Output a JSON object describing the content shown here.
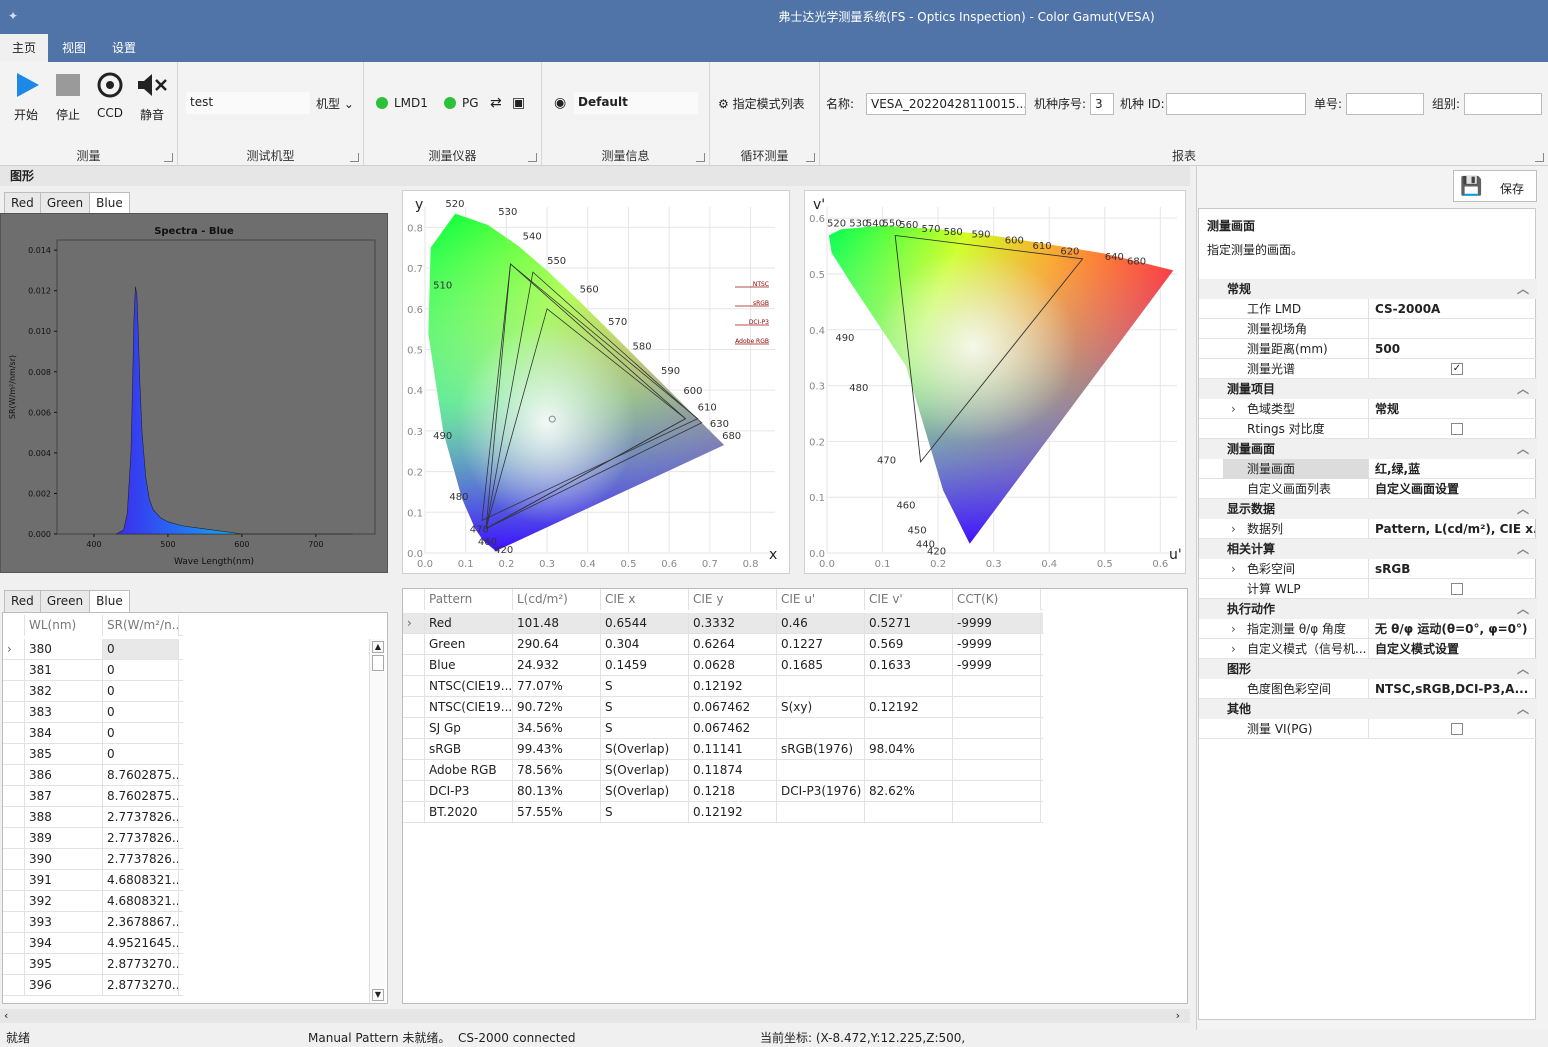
{
  "title": "弗士达光学测量系统(FS - Optics Inspection) - Color Gamut(VESA)",
  "menu": [
    "主页",
    "视图",
    "设置"
  ],
  "ribbon": {
    "start": "开始",
    "stop": "停止",
    "ccd": "CCD",
    "mute": "静音",
    "group_measure": "测量",
    "test_model_value": "test",
    "model_label": "机型",
    "group_test_model": "测试机型",
    "lmd": "LMD1",
    "pg": "PG",
    "group_instrument": "测量仪器",
    "info_value": "Default",
    "group_info": "测量信息",
    "pattern_list": "指定模式列表",
    "group_loop": "循环测量",
    "name_label": "名称:",
    "name_value": "VESA_20220428110015...",
    "seq_label": "机种序号:",
    "seq_value": "3",
    "model_id_label": "机种 ID:",
    "model_id_value": "",
    "order_label": "单号:",
    "order_value": "",
    "group_label": "组别:",
    "group_value": "",
    "group_report": "报表"
  },
  "section_graph": "图形",
  "color_tabs": [
    "Red",
    "Green",
    "Blue"
  ],
  "spectra": {
    "title": "Spectra - Blue",
    "xlabel": "Wave Length(nm)",
    "ylabel": "SR(W/m²/nm/sr)",
    "xticks": [
      "400",
      "500",
      "600",
      "700"
    ],
    "yticks": [
      "0.000",
      "0.002",
      "0.004",
      "0.006",
      "0.008",
      "0.010",
      "0.012",
      "0.014"
    ]
  },
  "cie_xy": {
    "xlabel": "x",
    "ylabel": "y",
    "xticks": [
      "0.0",
      "0.1",
      "0.2",
      "0.3",
      "0.4",
      "0.5",
      "0.6",
      "0.7",
      "0.8"
    ],
    "yticks": [
      "0.0",
      "0.1",
      "0.2",
      "0.3",
      "0.4",
      "0.5",
      "0.6",
      "0.7",
      "0.8"
    ],
    "legend": [
      "NTSC",
      "sRGB",
      "DCI-P3",
      "Adobe RGB"
    ],
    "wavelengths": [
      "420",
      "460",
      "470",
      "480",
      "490",
      "520",
      "530",
      "540",
      "550",
      "560",
      "570",
      "580",
      "590",
      "600",
      "610",
      "630",
      "680",
      "510"
    ]
  },
  "cie_uv": {
    "xlabel": "u'",
    "ylabel": "v'",
    "xticks": [
      "0.0",
      "0.1",
      "0.2",
      "0.3",
      "0.4",
      "0.5",
      "0.6"
    ],
    "yticks": [
      "0.0",
      "0.1",
      "0.2",
      "0.3",
      "0.4",
      "0.5",
      "0.6"
    ],
    "wavelengths": [
      "520",
      "530",
      "540",
      "550",
      "560",
      "570",
      "580",
      "590",
      "600",
      "610",
      "620",
      "640",
      "680",
      "490",
      "480",
      "470",
      "460",
      "450",
      "440",
      "420"
    ]
  },
  "wl_table": {
    "headers": [
      "WL(nm)",
      "SR(W/m²/n..."
    ],
    "rows": [
      [
        "380",
        "0"
      ],
      [
        "381",
        "0"
      ],
      [
        "382",
        "0"
      ],
      [
        "383",
        "0"
      ],
      [
        "384",
        "0"
      ],
      [
        "385",
        "0"
      ],
      [
        "386",
        "8.7602875..."
      ],
      [
        "387",
        "8.7602875..."
      ],
      [
        "388",
        "2.7737826..."
      ],
      [
        "389",
        "2.7737826..."
      ],
      [
        "390",
        "2.7737826..."
      ],
      [
        "391",
        "4.6808321..."
      ],
      [
        "392",
        "4.6808321..."
      ],
      [
        "393",
        "2.3678867..."
      ],
      [
        "394",
        "4.9521645..."
      ],
      [
        "395",
        "2.8773270..."
      ],
      [
        "396",
        "2.8773270..."
      ]
    ]
  },
  "result_table": {
    "headers": [
      "Pattern",
      "L(cd/m²)",
      "CIE x",
      "CIE y",
      "CIE u'",
      "CIE v'",
      "CCT(K)"
    ],
    "rows": [
      [
        "Red",
        "101.48",
        "0.6544",
        "0.3332",
        "0.46",
        "0.5271",
        "-9999"
      ],
      [
        "Green",
        "290.64",
        "0.304",
        "0.6264",
        "0.1227",
        "0.569",
        "-9999"
      ],
      [
        "Blue",
        "24.932",
        "0.1459",
        "0.0628",
        "0.1685",
        "0.1633",
        "-9999"
      ],
      [
        "NTSC(CIE19...",
        "77.07%",
        "S",
        "0.12192",
        "",
        "",
        ""
      ],
      [
        "NTSC(CIE19...",
        "90.72%",
        "S",
        "0.067462",
        "S(xy)",
        "0.12192",
        ""
      ],
      [
        "SJ Gp",
        "34.56%",
        "S",
        "0.067462",
        "",
        "",
        ""
      ],
      [
        "sRGB",
        "99.43%",
        "S(Overlap)",
        "0.11141",
        "sRGB(1976)",
        "98.04%",
        ""
      ],
      [
        "Adobe RGB",
        "78.56%",
        "S(Overlap)",
        "0.11874",
        "",
        "",
        ""
      ],
      [
        "DCI-P3",
        "80.13%",
        "S(Overlap)",
        "0.1218",
        "DCI-P3(1976)",
        "82.62%",
        ""
      ],
      [
        "BT.2020",
        "57.55%",
        "S",
        "0.12192",
        "",
        "",
        ""
      ]
    ]
  },
  "props": {
    "save": "保存",
    "head_title": "测量画面",
    "head_desc": "指定测量的画面。",
    "categories": [
      {
        "name": "常规",
        "items": [
          {
            "k": "工作 LMD",
            "v": "CS-2000A"
          },
          {
            "k": "测量视场角",
            "v": ""
          },
          {
            "k": "测量距离(mm)",
            "v": "500"
          },
          {
            "k": "测量光谱",
            "v": "",
            "check": true,
            "checked": true
          }
        ]
      },
      {
        "name": "测量项目",
        "items": [
          {
            "k": "色域类型",
            "v": "常规",
            "expand": true
          },
          {
            "k": "Rtings 对比度",
            "v": "",
            "check": true,
            "checked": false
          }
        ]
      },
      {
        "name": "测量画面",
        "items": [
          {
            "k": "测量画面",
            "v": "红,绿,蓝",
            "sel": true
          },
          {
            "k": "自定义画面列表",
            "v": "自定义画面设置"
          }
        ]
      },
      {
        "name": "显示数据",
        "items": [
          {
            "k": "数据列",
            "v": "Pattern, L(cd/m²), CIE x...",
            "expand": true
          }
        ]
      },
      {
        "name": "相关计算",
        "items": [
          {
            "k": "色彩空间",
            "v": "sRGB",
            "expand": true
          },
          {
            "k": "计算 WLP",
            "v": "",
            "check": true,
            "checked": false
          }
        ]
      },
      {
        "name": "执行动作",
        "items": [
          {
            "k": "指定测量 θ/φ 角度",
            "v": "无 θ/φ 运动(θ=0°, φ=0°)",
            "expand": true
          },
          {
            "k": "自定义模式（信号机...",
            "v": "自定义模式设置",
            "expand": true
          }
        ]
      },
      {
        "name": "图形",
        "items": [
          {
            "k": "色度图色彩空间",
            "v": "NTSC,sRGB,DCI-P3,A..."
          }
        ]
      },
      {
        "name": "其他",
        "items": [
          {
            "k": "测量 VI(PG)",
            "v": "",
            "check": true,
            "checked": false
          }
        ]
      }
    ]
  },
  "status": {
    "ready": "就绪",
    "pattern": "Manual Pattern 未就绪。",
    "device": "CS-2000 connected",
    "coord": "当前坐标: (X-8.472,Y:12.225,Z:500,"
  },
  "colors": {
    "accent": "#5073a8",
    "ok": "#2bc23a",
    "play": "#1e88e5"
  },
  "chart_data": {
    "type": "area",
    "title": "Spectra - Blue",
    "xlabel": "Wave Length(nm)",
    "ylabel": "SR(W/m²/nm/sr)",
    "xlim": [
      350,
      780
    ],
    "ylim": [
      0,
      0.0145
    ],
    "x": [
      430,
      440,
      445,
      450,
      452,
      454,
      456,
      458,
      460,
      462,
      465,
      470,
      475,
      480,
      490,
      500,
      520,
      540,
      560,
      580,
      600,
      650,
      700,
      750
    ],
    "y": [
      0,
      0.0002,
      0.001,
      0.004,
      0.007,
      0.0105,
      0.0122,
      0.0118,
      0.0098,
      0.0075,
      0.005,
      0.0028,
      0.0017,
      0.0012,
      0.0008,
      0.0006,
      0.0004,
      0.0003,
      0.0002,
      0.0001,
      0,
      0,
      0,
      0
    ]
  }
}
